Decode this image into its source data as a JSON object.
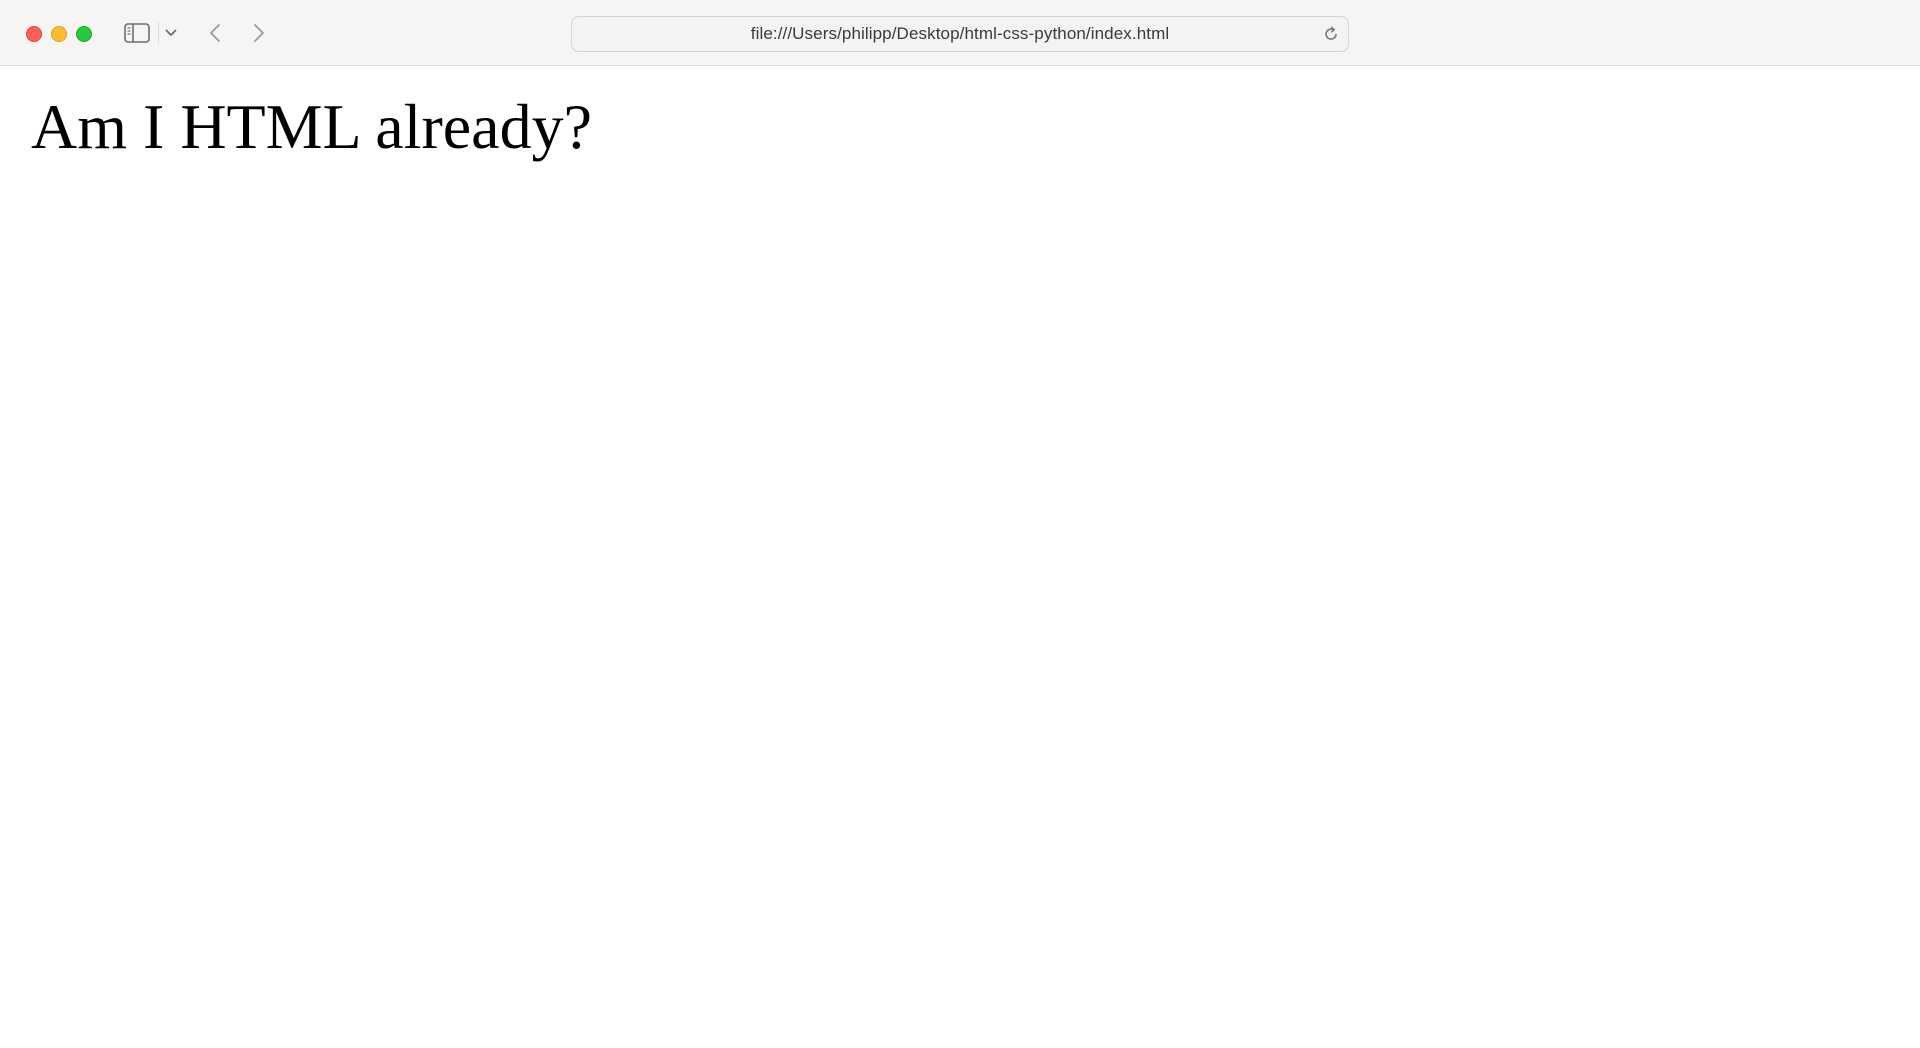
{
  "browser": {
    "address_bar": {
      "url": "file:///Users/philipp/Desktop/html-css-python/index.html"
    },
    "window_controls": {
      "close_color": "#fe5f57",
      "minimize_color": "#febc2e",
      "zoom_color": "#28c840"
    },
    "toolbar_icons": {
      "sidebar": "sidebar-icon",
      "sidebar_menu": "chevron-down-icon",
      "back": "chevron-left-icon",
      "forward": "chevron-right-icon",
      "reload": "reload-icon"
    }
  },
  "page": {
    "heading": "Am I HTML already?"
  }
}
